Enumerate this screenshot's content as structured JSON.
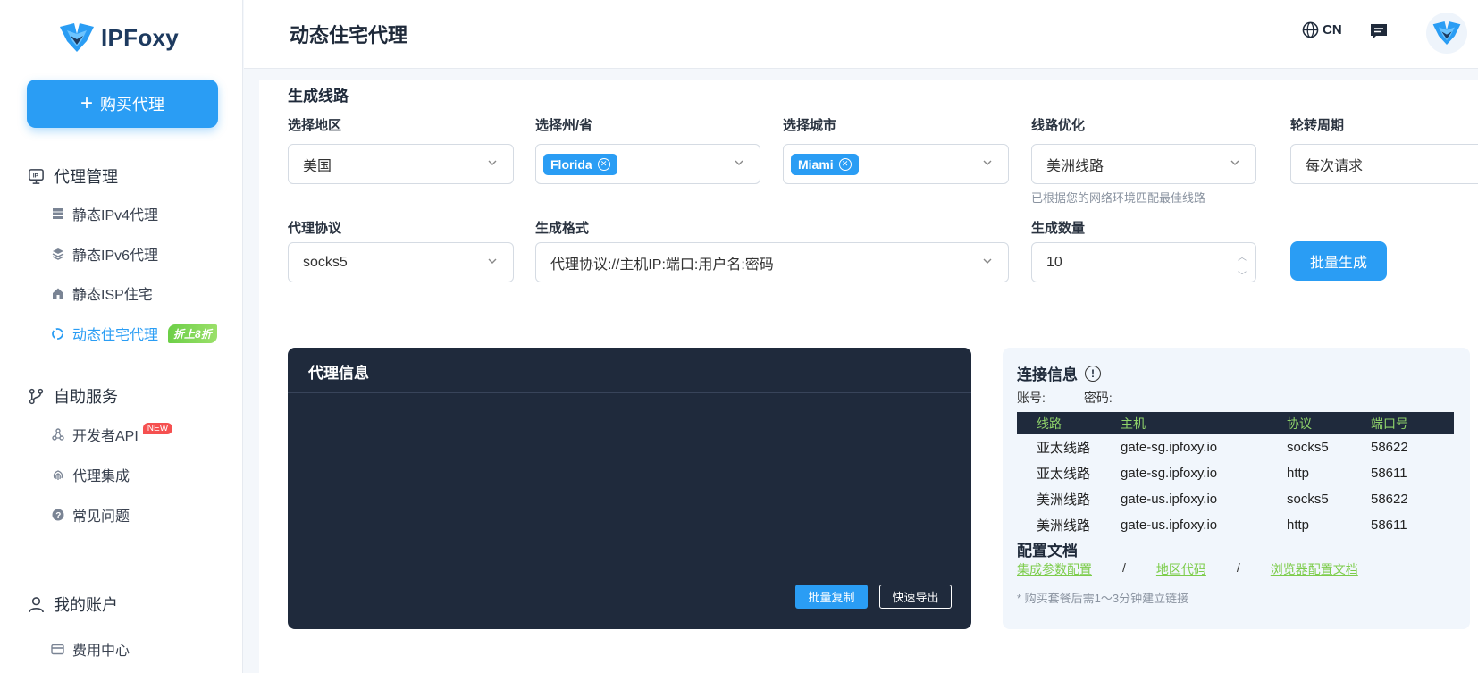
{
  "brand": {
    "name": "IPFoxy"
  },
  "sidebar": {
    "buy_label": "购买代理",
    "groups": [
      {
        "label": "代理管理",
        "items": [
          {
            "label": "静态IPv4代理"
          },
          {
            "label": "静态IPv6代理"
          },
          {
            "label": "静态ISP住宅"
          },
          {
            "label": "动态住宅代理",
            "badge": "折上8折"
          }
        ]
      },
      {
        "label": "自助服务",
        "items": [
          {
            "label": "开发者API",
            "badge": "NEW"
          },
          {
            "label": "代理集成"
          },
          {
            "label": "常见问题"
          }
        ]
      },
      {
        "label": "我的账户",
        "items": [
          {
            "label": "费用中心"
          }
        ]
      }
    ]
  },
  "header": {
    "title": "动态住宅代理",
    "lang": "CN"
  },
  "form": {
    "section_title": "生成线路",
    "region": {
      "label": "选择地区",
      "value": "美国"
    },
    "state": {
      "label": "选择州/省",
      "tag": "Florida"
    },
    "city": {
      "label": "选择城市",
      "tag": "Miami"
    },
    "route": {
      "label": "线路优化",
      "value": "美洲线路",
      "hint": "已根据您的网络环境匹配最佳线路"
    },
    "rotation": {
      "label": "轮转周期",
      "value": "每次请求"
    },
    "protocol": {
      "label": "代理协议",
      "value": "socks5"
    },
    "format": {
      "label": "生成格式",
      "value": "代理协议://主机IP:端口:用户名:密码"
    },
    "quantity": {
      "label": "生成数量",
      "value": "10"
    },
    "generate_label": "批量生成"
  },
  "proxy_panel": {
    "title": "代理信息",
    "copy_label": "批量复制",
    "export_label": "快速导出"
  },
  "connection": {
    "title": "连接信息",
    "account_label": "账号:",
    "password_label": "密码:",
    "headers": [
      "线路",
      "主机",
      "协议",
      "端口号"
    ],
    "rows": [
      [
        "亚太线路",
        "gate-sg.ipfoxy.io",
        "socks5",
        "58622"
      ],
      [
        "亚太线路",
        "gate-sg.ipfoxy.io",
        "http",
        "58611"
      ],
      [
        "美洲线路",
        "gate-us.ipfoxy.io",
        "socks5",
        "58622"
      ],
      [
        "美洲线路",
        "gate-us.ipfoxy.io",
        "http",
        "58611"
      ]
    ],
    "docs_title": "配置文档",
    "links": [
      "集成参数配置",
      "地区代码",
      "浏览器配置文档"
    ],
    "separator": "/",
    "note": "* 购买套餐后需1～3分钟建立链接"
  },
  "colors": {
    "accent": "#2a9df4",
    "dark_panel": "#1f2a3c",
    "link_green": "#7ccc4a"
  }
}
